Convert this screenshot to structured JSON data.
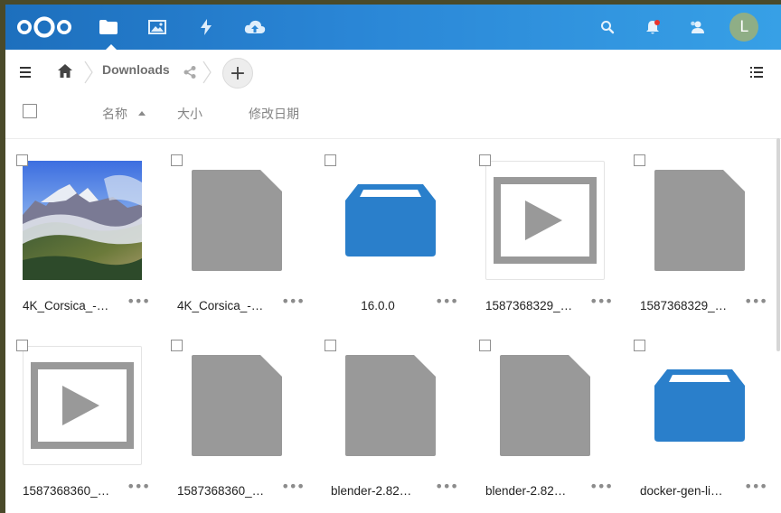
{
  "header": {
    "logo_icon": "nextcloud-logo",
    "apps": [
      {
        "name": "files",
        "icon": "folder-icon",
        "active": true
      },
      {
        "name": "photos",
        "icon": "image-icon"
      },
      {
        "name": "activity",
        "icon": "lightning-icon"
      },
      {
        "name": "upload",
        "icon": "cloud-upload-icon"
      }
    ],
    "avatar_letter": "L",
    "colors": {
      "gradient_start": "#1d6fbd",
      "gradient_end": "#37a0e6",
      "notification_dot": "#e9322d",
      "avatar_bg": "#8fae86"
    }
  },
  "controls": {
    "breadcrumb_current": "Downloads",
    "new_label": "+"
  },
  "table_header": {
    "name": "名称",
    "size": "大小",
    "modified": "修改日期"
  },
  "files": [
    {
      "name": "4K_Corsica_-…",
      "type": "image"
    },
    {
      "name": "4K_Corsica_-…",
      "type": "document"
    },
    {
      "name": "16.0.0",
      "type": "folder"
    },
    {
      "name": "1587368329_…",
      "type": "video"
    },
    {
      "name": "1587368329_…",
      "type": "document"
    },
    {
      "name": "1587368360_…",
      "type": "video"
    },
    {
      "name": "1587368360_…",
      "type": "document"
    },
    {
      "name": "blender-2.82…",
      "type": "document"
    },
    {
      "name": "blender-2.82…",
      "type": "document"
    },
    {
      "name": "docker-gen-li…",
      "type": "folder"
    }
  ],
  "more_label": "•••",
  "colors": {
    "folder": "#2a7fcb",
    "document": "#999999"
  }
}
